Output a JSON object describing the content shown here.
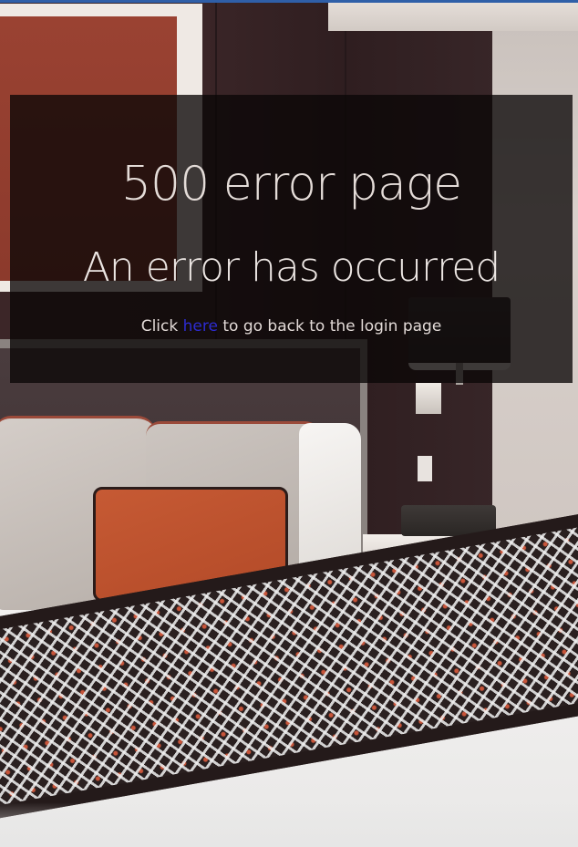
{
  "error_panel": {
    "title": "500 error page",
    "subtitle": "An error has occurred",
    "message_prefix": "Click",
    "link_text": "here",
    "message_suffix": "to go back to the login page"
  },
  "colors": {
    "top_strip": "#2f5fa8",
    "overlay": "rgba(10, 6, 6, 0.78)",
    "heading_text": "#e4dcd8",
    "link": "#2d2bd1"
  }
}
